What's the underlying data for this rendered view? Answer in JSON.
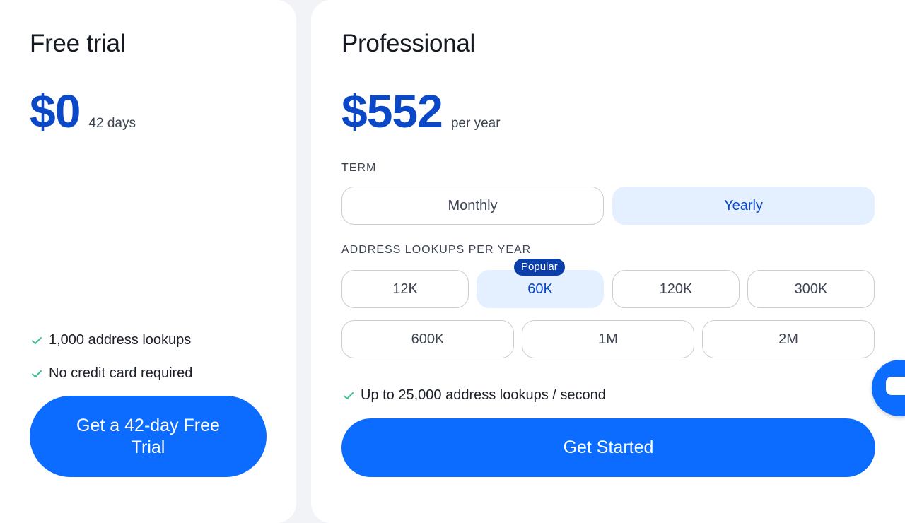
{
  "free": {
    "title": "Free trial",
    "price": "$0",
    "price_note": "42 days",
    "features": [
      "1,000 address lookups",
      "No credit card required"
    ],
    "cta": "Get a 42-day Free Trial"
  },
  "pro": {
    "title": "Professional",
    "price": "$552",
    "price_note": "per year",
    "term_label": "TERM",
    "terms": [
      "Monthly",
      "Yearly"
    ],
    "selected_term": "Yearly",
    "lookups_label": "ADDRESS LOOKUPS PER YEAR",
    "lookups": [
      "12K",
      "60K",
      "120K",
      "300K",
      "600K",
      "1M",
      "2M"
    ],
    "selected_lookup": "60K",
    "popular_badge": "Popular",
    "feature": "Up to 25,000 address lookups / second",
    "cta": "Get Started"
  },
  "colors": {
    "accent": "#0b6cff",
    "price": "#0b48c8",
    "selected_bg": "#e4f0ff",
    "check": "#3ec08b"
  },
  "icons": [
    "check-icon",
    "chat-icon"
  ]
}
